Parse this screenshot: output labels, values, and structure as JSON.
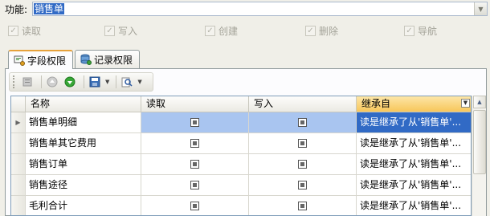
{
  "function": {
    "label": "功能:",
    "value": "销售单"
  },
  "permissions": [
    {
      "label": "读取",
      "checked": true
    },
    {
      "label": "写入",
      "checked": true
    },
    {
      "label": "创建",
      "checked": true
    },
    {
      "label": "删除",
      "checked": true
    },
    {
      "label": "导航",
      "checked": true
    }
  ],
  "tabs": [
    {
      "label": "字段权限",
      "active": true
    },
    {
      "label": "记录权限",
      "active": false
    }
  ],
  "grid": {
    "columns": [
      "名称",
      "读取",
      "写入",
      "继承自"
    ],
    "rows": [
      {
        "name": "销售单明细",
        "read": true,
        "write": true,
        "inherit": "读是继承了从'销售单'..."
      },
      {
        "name": "销售单其它费用",
        "read": true,
        "write": true,
        "inherit": "读是继承了从'销售单'..."
      },
      {
        "name": "销售订单",
        "read": true,
        "write": true,
        "inherit": "读是继承了从'销售单'..."
      },
      {
        "name": "销售途径",
        "read": true,
        "write": true,
        "inherit": "读是继承了从'销售单'..."
      },
      {
        "name": "毛利合计",
        "read": true,
        "write": true,
        "inherit": "读是继承了从'销售单'..."
      }
    ]
  },
  "colors": {
    "selection": "#316ac5",
    "sorted_header": "#f7c65a"
  }
}
